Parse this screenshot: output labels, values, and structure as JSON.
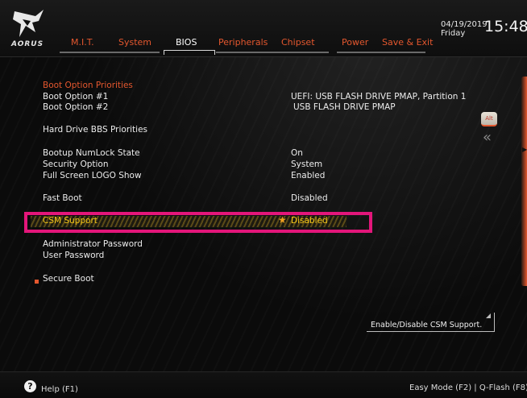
{
  "brand": {
    "logo_text": "AORUS"
  },
  "header": {
    "date": "04/19/2019",
    "day": "Friday",
    "time": "15:48"
  },
  "tabs": [
    {
      "label": "M.I.T.",
      "active": false
    },
    {
      "label": "System",
      "active": false
    },
    {
      "label": "BIOS",
      "active": true
    },
    {
      "label": "Peripherals",
      "active": false
    },
    {
      "label": "Chipset",
      "active": false
    },
    {
      "label": "Power",
      "active": false
    },
    {
      "label": "Save & Exit",
      "active": false
    }
  ],
  "menu": {
    "boot_priorities_header": "Boot Option Priorities",
    "boot_option_1_label": "Boot Option #1",
    "boot_option_1_value": "UEFI:  USB FLASH DRIVE PMAP, Partition 1",
    "boot_option_2_label": "Boot Option #2",
    "boot_option_2_value": "USB FLASH DRIVE PMAP",
    "hdd_bbs_label": "Hard Drive BBS Priorities",
    "numlock_label": "Bootup NumLock State",
    "numlock_value": "On",
    "security_label": "Security Option",
    "security_value": "System",
    "logo_show_label": "Full Screen LOGO Show",
    "logo_show_value": "Enabled",
    "fast_boot_label": "Fast Boot",
    "fast_boot_value": "Disabled",
    "csm_label": "CSM Support",
    "csm_value": "Disabled",
    "admin_pw_label": "Administrator Password",
    "user_pw_label": "User Password",
    "secure_boot_label": "Secure Boot"
  },
  "side": {
    "alt_key_label": "Alt",
    "collapse_glyph": "«"
  },
  "help_panel": {
    "text": "Enable/Disable CSM Support."
  },
  "footer": {
    "help_glyph": "?",
    "help_label": "Help (F1)",
    "right_label": "Easy Mode (F2) | Q-Flash (F8)"
  },
  "colors": {
    "accent": "#e4572e",
    "highlight_text": "#f5c518",
    "selection_box": "#e3167a"
  }
}
